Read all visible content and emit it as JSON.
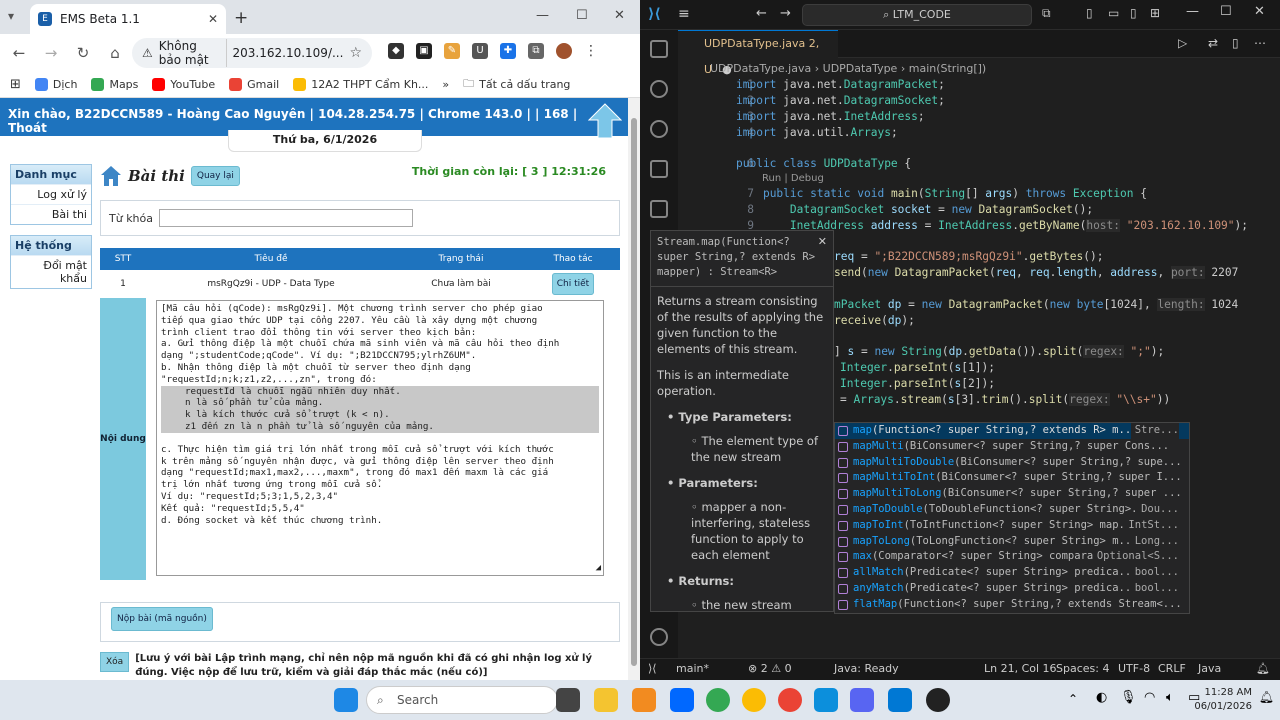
{
  "chrome": {
    "tab_title": "EMS Beta 1.1",
    "security_label": "Không bảo mật",
    "url": "203.162.10.109/...",
    "bookmarks": [
      "Dịch",
      "Maps",
      "YouTube",
      "Gmail",
      "12A2 THPT Cẩm Kh...",
      "Tất cả dấu trang"
    ]
  },
  "page": {
    "greeting": "Xin chào, B22DCCN589 - Hoàng Cao Nguyên | 104.28.254.75 | Chrome 143.0 | | 168 | Thoát",
    "date": "Thứ ba, 6/1/2026",
    "sidebar": {
      "menu_title": "Danh mục",
      "menu_items": [
        "Log xử lý",
        "Bài thi"
      ],
      "system_title": "Hệ thống",
      "system_items": [
        "Đổi mật khẩu"
      ]
    },
    "section_title": "Bài thi",
    "back_button": "Quay lại",
    "timer": "Thời gian còn lại: [ 3 ] 12:31:26",
    "keyword_label": "Từ khóa",
    "table": {
      "headers": [
        "STT",
        "Tiêu đề",
        "Trạng thái",
        "Thao tác"
      ],
      "row": {
        "stt": "1",
        "title": "msRgQz9i - UDP - Data Type",
        "status": "Chưa làm bài",
        "action": "Chi tiết"
      }
    },
    "content_label": "Nội dung",
    "content_lines": [
      "[Mã câu hỏi (qCode): msRgQz9i].  Một chương trình server cho phép giao",
      "tiếp qua giao thức UDP tại cổng 2207. Yêu cầu là xây dựng một chương",
      "trình client trao đổi thông tin với server theo kịch bản:",
      "a. Gửi thông điệp là một chuỗi chứa mã sinh viên và mã câu hỏi theo định",
      "dạng \";studentCode;qCode\". Ví dụ: \";B21DCCN795;ylrhZ6UM\".",
      "b. Nhận thông điệp là một chuỗi từ server theo định dạng",
      "\"requestId;n;k;z1,z2,...,zn\", trong đó:"
    ],
    "content_highlight": [
      "requestId là chuỗi ngẫu nhiên duy nhất.",
      "n là số phần tử của mảng.",
      "k là kích thước cửa sổ trượt (k < n).",
      "z1 đến zn là n phần tử là số nguyên của mảng."
    ],
    "content_lines2": [
      "c. Thực hiện tìm giá trị lớn nhất trong mỗi cửa sổ trượt với kích thước",
      "k trên mảng số nguyên nhận được, và gửi thông điệp lên server theo định",
      "dạng \"requestId;max1,max2,...,maxm\", trong đó max1 đến maxm là các giá",
      "trị lớn nhất tương ứng trong mỗi cửa sổ.",
      "Ví dụ: \"requestId;5;3;1,5,2,3,4\"",
      "Kết quả: \"requestId;5,5,4\"",
      "d. Đóng socket và kết thúc chương trình."
    ],
    "submit_button": "Nộp bài (mã nguồn)",
    "clear_button": "Xóa",
    "note": "[Lưu ý với bài Lập trình mạng, chỉ nên nộp mã nguồn khi đã có ghi nhận log xử lý đúng. Việc nộp để lưu trữ, kiểm và giải đáp thắc mắc (nếu có)]"
  },
  "vscode": {
    "search": "LTM_CODE",
    "tab": "UDPDataType.java 2, U",
    "breadcrumb": [
      "UDPDataType.java",
      "UDPDataType",
      "main(String[])"
    ],
    "codelens": "Run | Debug",
    "hover": {
      "signature": "Stream.map(Function<? super String,? extends R> mapper) : Stream<R>",
      "desc": "Returns a stream consisting of the results of applying the given function to the elements of this stream.",
      "note": "This is an intermediate operation.",
      "type_params_label": "Type Parameters:",
      "type_param": "The element type of the new stream",
      "params_label": "Parameters:",
      "param": "mapper a non-interfering, stateless function to apply to each element",
      "returns_label": "Returns:",
      "returns": "the new stream"
    },
    "suggestions": [
      {
        "name": "map",
        "sig": "(Function<? super String,? extends R> m...",
        "ret": "Stre..."
      },
      {
        "name": "mapMulti",
        "sig": "(BiConsumer<? super String,? super Cons...",
        "ret": ""
      },
      {
        "name": "mapMultiToDouble",
        "sig": "(BiConsumer<? super String,? supe...",
        "ret": ""
      },
      {
        "name": "mapMultiToInt",
        "sig": "(BiConsumer<? super String,? super I...",
        "ret": ""
      },
      {
        "name": "mapMultiToLong",
        "sig": "(BiConsumer<? super String,? super ...",
        "ret": ""
      },
      {
        "name": "mapToDouble",
        "sig": "(ToDoubleFunction<? super String>...",
        "ret": "Dou..."
      },
      {
        "name": "mapToInt",
        "sig": "(ToIntFunction<? super String> map...",
        "ret": "IntSt..."
      },
      {
        "name": "mapToLong",
        "sig": "(ToLongFunction<? super String> m...",
        "ret": "Long..."
      },
      {
        "name": "max",
        "sig": "(Comparator<? super String> compara...",
        "ret": "Optional<S..."
      },
      {
        "name": "allMatch",
        "sig": "(Predicate<? super String> predica...",
        "ret": "bool..."
      },
      {
        "name": "anyMatch",
        "sig": "(Predicate<? super String> predica...",
        "ret": "bool..."
      },
      {
        "name": "flatMap",
        "sig": "(Function<? super String,? extends Stream<...",
        "ret": ""
      }
    ],
    "status": {
      "branch": "main*",
      "problems": "⊗ 2 ⚠ 0",
      "java": "Java: Ready",
      "position": "Ln 21, Col 16",
      "spaces": "Spaces: 4",
      "encoding": "UTF-8",
      "eol": "CRLF",
      "lang": "Java"
    }
  },
  "taskbar": {
    "search": "Search",
    "time": "11:28 AM",
    "date": "06/01/2026"
  },
  "colors": {
    "ems_blue": "#1e73be",
    "button_cyan": "#8fd3e6",
    "vscode_bg": "#1f1f1f"
  }
}
